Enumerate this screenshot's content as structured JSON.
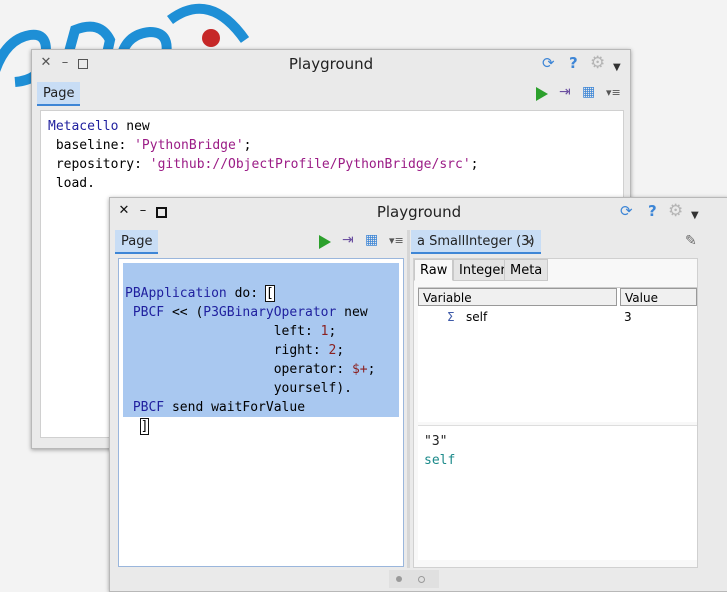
{
  "back_window": {
    "title": "Playground",
    "tab_label": "Page",
    "code_lines": [
      [
        {
          "t": "Metacello",
          "c": "kw"
        },
        {
          "t": " new",
          "c": ""
        }
      ],
      [
        {
          "t": " baseline: ",
          "c": ""
        },
        {
          "t": "'PythonBridge'",
          "c": "str"
        },
        {
          "t": ";",
          "c": ""
        }
      ],
      [
        {
          "t": " repository: ",
          "c": ""
        },
        {
          "t": "'github://ObjectProfile/PythonBridge/src'",
          "c": "str"
        },
        {
          "t": ";",
          "c": ""
        }
      ],
      [
        {
          "t": " load.",
          "c": ""
        }
      ]
    ]
  },
  "front_window": {
    "title": "Playground",
    "tab_label": "Page",
    "code_lines": [
      [
        {
          "t": "",
          "c": ""
        }
      ],
      [
        {
          "t": "PBApplication",
          "c": "kw"
        },
        {
          "t": " do: ",
          "c": ""
        },
        {
          "t": "[",
          "c": "caret"
        }
      ],
      [
        {
          "t": " PBCF",
          "c": "kw"
        },
        {
          "t": " << (",
          "c": ""
        },
        {
          "t": "P3GBinaryOperator",
          "c": "kw"
        },
        {
          "t": " new",
          "c": ""
        }
      ],
      [
        {
          "t": "                   left: ",
          "c": ""
        },
        {
          "t": "1",
          "c": "num"
        },
        {
          "t": ";",
          "c": ""
        }
      ],
      [
        {
          "t": "                   right: ",
          "c": ""
        },
        {
          "t": "2",
          "c": "num"
        },
        {
          "t": ";",
          "c": ""
        }
      ],
      [
        {
          "t": "                   operator: ",
          "c": ""
        },
        {
          "t": "$+",
          "c": "num"
        },
        {
          "t": ";",
          "c": ""
        }
      ],
      [
        {
          "t": "                   yourself).",
          "c": ""
        }
      ],
      [
        {
          "t": " PBCF",
          "c": "kw"
        },
        {
          "t": " send waitForValue",
          "c": ""
        }
      ],
      [
        {
          "t": "  ",
          "c": ""
        },
        {
          "t": "]",
          "c": "caret"
        }
      ]
    ],
    "inspector": {
      "tab_label": "a SmallInteger (3)",
      "subtabs": [
        "Raw",
        "Integer",
        "Meta"
      ],
      "columns": [
        "Variable",
        "Value"
      ],
      "rows": [
        {
          "icon": "Σ",
          "variable": "self",
          "value": "3"
        }
      ],
      "eval_output": "\"3\"",
      "eval_input": "self"
    }
  },
  "colors": {
    "accent": "#3e86d6",
    "play": "#2ca02c",
    "selection": "#a9c8f0"
  },
  "icons": [
    "close-icon",
    "minimize-icon",
    "maximize-icon",
    "refresh-icon",
    "help-icon",
    "gear-icon",
    "dropdown-icon",
    "play-icon",
    "export-icon",
    "table-icon",
    "list-menu-icon",
    "inspect-icon",
    "sum-icon"
  ]
}
